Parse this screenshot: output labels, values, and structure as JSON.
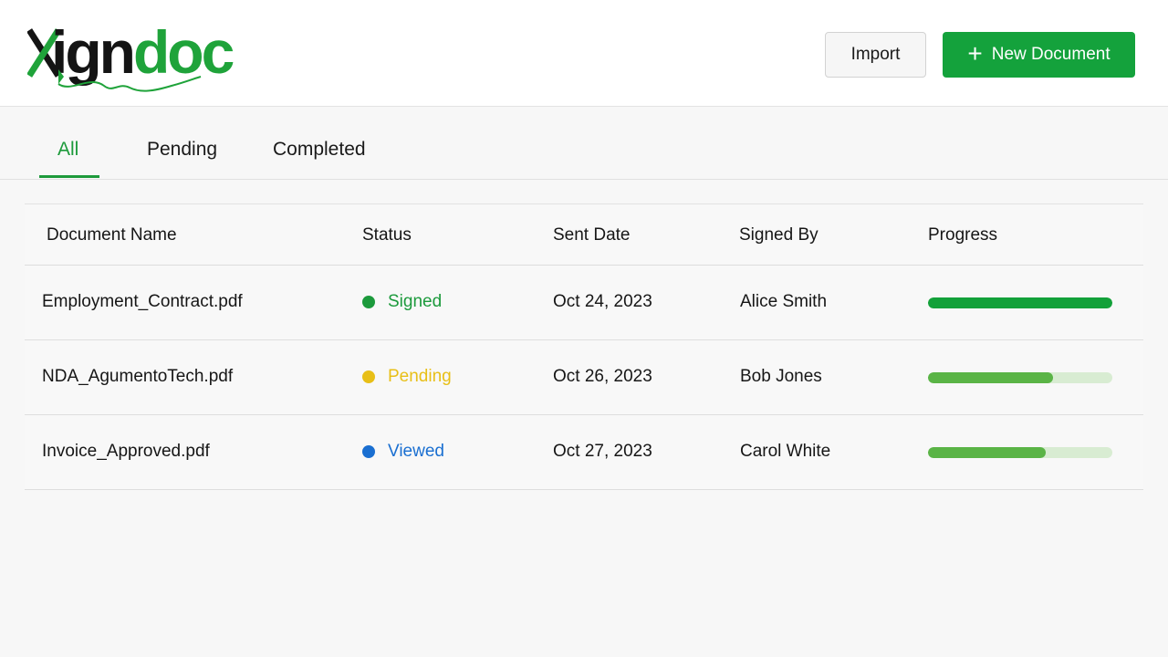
{
  "app": {
    "logo_text": "xigndoc",
    "brand_color": "#1fa33a"
  },
  "header": {
    "import_label": "Import",
    "new_document_label": "New Document",
    "new_document_icon": "plus-icon"
  },
  "tabs": [
    {
      "label": "All",
      "active": true
    },
    {
      "label": "Pending",
      "active": false
    },
    {
      "label": "Completed",
      "active": false
    }
  ],
  "table": {
    "columns": [
      "Document Name",
      "Status",
      "Sent Date",
      "Signed By",
      "Progress"
    ],
    "rows": [
      {
        "name": "Employment_Contract.pdf",
        "status": "Signed",
        "status_color": "#1c9a3c",
        "sent_date": "Oct 24, 2023",
        "signed_by": "Alice Smith",
        "progress": 1.0,
        "progress_color": "#13a13a"
      },
      {
        "name": "NDA_AgumentoTech.pdf",
        "status": "Pending",
        "status_color": "#e8bf17",
        "sent_date": "Oct 26, 2023",
        "signed_by": "Bob Jones",
        "progress": 0.68,
        "progress_color": "#5ab446"
      },
      {
        "name": "Invoice_Approved.pdf",
        "status": "Viewed",
        "status_color": "#1a6fd1",
        "sent_date": "Oct 27, 2023",
        "signed_by": "Carol White",
        "progress": 0.64,
        "progress_color": "#5ab446"
      }
    ]
  }
}
